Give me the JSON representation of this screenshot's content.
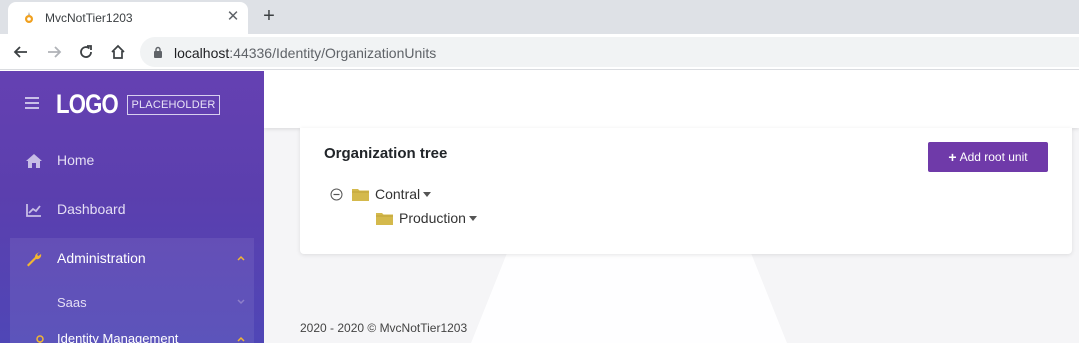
{
  "browser": {
    "tab_title": "MvcNotTier1203",
    "url_host": "localhost",
    "url_rest": ":44336/Identity/OrganizationUnits"
  },
  "sidebar": {
    "logo_main": "LOGO",
    "logo_sub": "PLACEHOLDER",
    "items": [
      {
        "label": "Home",
        "icon": "home-icon"
      },
      {
        "label": "Dashboard",
        "icon": "chart-line-icon"
      },
      {
        "label": "Administration",
        "icon": "wrench-icon"
      }
    ],
    "sub_items": [
      {
        "label": "Saas"
      },
      {
        "label": "Identity Management"
      }
    ]
  },
  "card": {
    "title": "Organization tree",
    "add_button_label": "Add root unit"
  },
  "tree": [
    {
      "label": "Contral",
      "level": 0,
      "expanded": true
    },
    {
      "label": "Production",
      "level": 1
    }
  ],
  "footer": {
    "text": "2020 - 2020 © MvcNotTier1203"
  },
  "colors": {
    "sidebar_top": "#6541b2",
    "sidebar_bottom": "#4f46b6",
    "accent_button": "#6f3aa9",
    "folder": "#d4b94c"
  }
}
